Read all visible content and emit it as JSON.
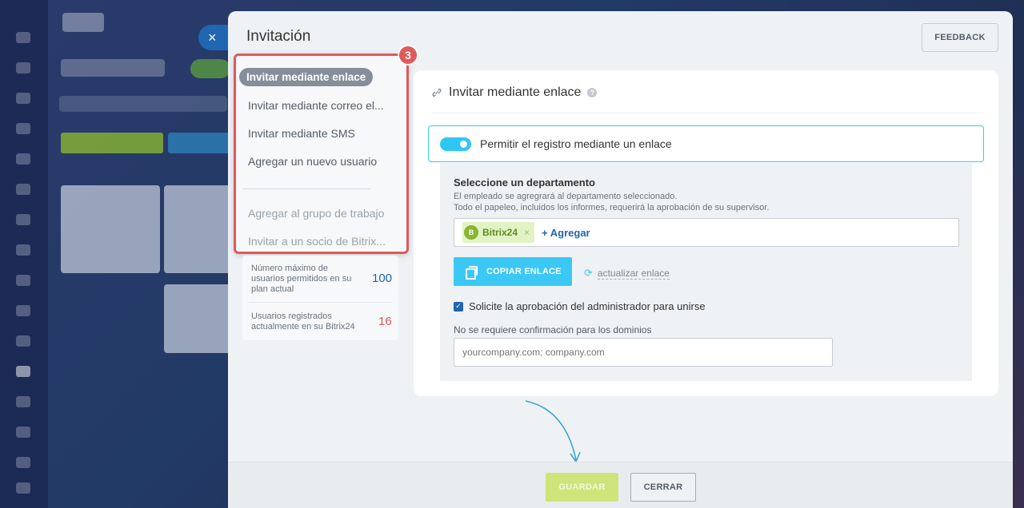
{
  "modal": {
    "title": "Invitación",
    "feedback_label": "FEEDBACK",
    "close_icon": "×"
  },
  "nav": {
    "badge": "3",
    "items": [
      {
        "label": "Invitar mediante enlace"
      },
      {
        "label": "Invitar mediante correo el..."
      },
      {
        "label": "Invitar mediante SMS"
      },
      {
        "label": "Agregar un nuevo usuario"
      },
      {
        "label": "Agregar al grupo de trabajo"
      },
      {
        "label": "Invitar a un socio de Bitrix..."
      }
    ]
  },
  "stats": {
    "max_users_label": "Número máximo de usuarios permitidos en su plan actual",
    "max_users_value": "100",
    "max_users_color": "#2066b0",
    "registered_label": "Usuarios registrados actualmente en su Bitrix24",
    "registered_value": "16",
    "registered_color": "#e0595b"
  },
  "panel": {
    "heading": "Invitar mediante enlace",
    "help_icon": "?",
    "toggle_label": "Permitir el registro mediante un enlace",
    "toggle_on": true,
    "dept_title": "Seleccione un departamento",
    "dept_desc_1": "El empleado se agregrará al departamento seleccionado.",
    "dept_desc_2": "Todo el papeleo, incluidos los informes, requerirá la aprobación de su supervisor.",
    "dept_tag": "Bitrix24",
    "dept_tag_icon": "B",
    "dept_tag_remove": "×",
    "add_link": "+ Agregar",
    "copy_button": "COPIAR ENLACE",
    "refresh_link": "actualizar enlace",
    "approval_label": "Solicite la aprobación del administrador para unirse",
    "approval_checked": true,
    "domains_label": "No se requiere confirmación para los dominios",
    "domains_placeholder": "yourcompany.com; company.com",
    "domains_value": ""
  },
  "footer": {
    "save_label": "GUARDAR",
    "close_label": "CERRAR"
  },
  "colors": {
    "accent": "#3bc8f5",
    "highlight_border": "#e0595b",
    "save_disabled": "#cde57a"
  }
}
